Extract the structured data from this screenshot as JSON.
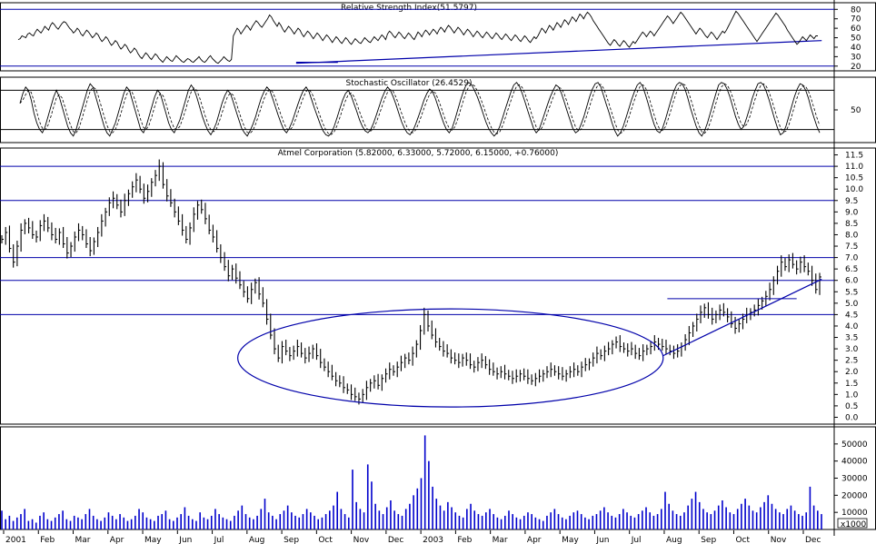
{
  "chart_data": [
    {
      "type": "line",
      "title": "Relative Strength Index(51.5797)",
      "y_ticks": [
        20,
        30,
        40,
        50,
        60,
        70,
        80
      ],
      "ylim": [
        15,
        87
      ],
      "horizontal_lines": [
        80,
        20
      ],
      "trendline_label": "",
      "trendlines": [
        {
          "x1": 0.355,
          "y1": 23,
          "x2": 0.985,
          "y2": 47
        },
        {
          "x1": 0.355,
          "y1": 24,
          "x2": 0.405,
          "y2": 24
        }
      ],
      "series": [
        {
          "values": [
            48,
            49,
            52,
            51,
            50,
            54,
            55,
            53,
            52,
            56,
            59,
            57,
            55,
            58,
            62,
            60,
            58,
            63,
            66,
            64,
            61,
            59,
            62,
            65,
            67,
            66,
            63,
            60,
            58,
            55,
            57,
            60,
            58,
            54,
            52,
            55,
            58,
            56,
            53,
            50,
            52,
            55,
            53,
            49,
            46,
            48,
            51,
            49,
            45,
            42,
            44,
            47,
            45,
            41,
            38,
            40,
            43,
            41,
            37,
            34,
            36,
            39,
            37,
            33,
            30,
            28,
            31,
            34,
            32,
            29,
            27,
            30,
            33,
            31,
            28,
            26,
            24,
            27,
            30,
            28,
            26,
            25,
            28,
            31,
            29,
            27,
            25,
            24,
            26,
            28,
            27,
            25,
            24,
            26,
            28,
            30,
            27,
            25,
            24,
            26,
            29,
            31,
            28,
            26,
            24,
            23,
            25,
            27,
            30,
            28,
            26,
            25,
            27,
            52,
            56,
            60,
            58,
            54,
            57,
            60,
            63,
            61,
            58,
            62,
            65,
            68,
            66,
            63,
            61,
            64,
            67,
            70,
            74,
            72,
            68,
            65,
            62,
            66,
            63,
            59,
            56,
            59,
            62,
            60,
            57,
            54,
            57,
            60,
            58,
            54,
            51,
            54,
            57,
            55,
            52,
            49,
            52,
            55,
            53,
            50,
            47,
            50,
            53,
            51,
            48,
            45,
            48,
            51,
            49,
            46,
            44,
            47,
            50,
            48,
            45,
            43,
            46,
            49,
            47,
            45,
            44,
            47,
            50,
            48,
            46,
            45,
            48,
            51,
            49,
            47,
            50,
            53,
            51,
            48,
            54,
            57,
            55,
            52,
            50,
            53,
            56,
            54,
            51,
            49,
            52,
            55,
            53,
            50,
            48,
            52,
            56,
            54,
            51,
            55,
            58,
            56,
            53,
            56,
            59,
            57,
            54,
            58,
            61,
            59,
            56,
            60,
            63,
            61,
            58,
            55,
            58,
            61,
            59,
            56,
            53,
            56,
            59,
            57,
            54,
            51,
            54,
            57,
            55,
            52,
            50,
            53,
            56,
            54,
            51,
            49,
            52,
            55,
            53,
            50,
            48,
            51,
            54,
            52,
            49,
            47,
            50,
            53,
            51,
            48,
            46,
            49,
            52,
            50,
            47,
            45,
            48,
            51,
            49,
            52,
            56,
            60,
            58,
            55,
            59,
            63,
            61,
            58,
            62,
            66,
            64,
            61,
            65,
            69,
            67,
            64,
            68,
            72,
            70,
            67,
            71,
            75,
            73,
            70,
            74,
            77,
            75,
            72,
            68,
            65,
            62,
            59,
            56,
            53,
            50,
            47,
            44,
            42,
            45,
            48,
            46,
            43,
            41,
            44,
            47,
            45,
            42,
            40,
            43,
            46,
            44,
            47,
            50,
            53,
            56,
            54,
            51,
            54,
            57,
            55,
            52,
            55,
            58,
            61,
            64,
            67,
            70,
            73,
            71,
            68,
            65,
            68,
            71,
            74,
            77,
            75,
            72,
            69,
            66,
            63,
            60,
            57,
            54,
            57,
            60,
            58,
            55,
            52,
            50,
            53,
            56,
            54,
            51,
            48,
            51,
            54,
            57,
            55,
            58,
            62,
            66,
            70,
            74,
            78,
            76,
            73,
            70,
            67,
            64,
            61,
            58,
            55,
            52,
            49,
            46,
            49,
            52,
            55,
            58,
            61,
            64,
            67,
            70,
            73,
            76,
            74,
            71,
            68,
            65,
            62,
            58,
            55,
            52,
            49,
            46,
            43,
            45,
            48,
            51,
            49,
            47,
            50,
            53,
            51,
            49,
            52,
            52
          ]
        }
      ]
    },
    {
      "type": "line",
      "title": "Stochastic Oscillator (26.4529)",
      "y_ticks": [
        50
      ],
      "ylim": [
        0,
        100
      ],
      "horizontal_lines": [
        80,
        20
      ],
      "series": [
        {
          "style": "solid"
        },
        {
          "style": "dashed"
        }
      ],
      "values": [
        60,
        75,
        85,
        80,
        65,
        45,
        30,
        20,
        15,
        25,
        40,
        55,
        70,
        80,
        70,
        55,
        40,
        25,
        15,
        10,
        20,
        35,
        50,
        65,
        80,
        90,
        85,
        70,
        55,
        40,
        25,
        15,
        10,
        20,
        30,
        45,
        60,
        75,
        85,
        80,
        65,
        50,
        35,
        20,
        15,
        25,
        40,
        55,
        70,
        80,
        75,
        60,
        45,
        30,
        20,
        15,
        25,
        35,
        50,
        65,
        80,
        88,
        82,
        70,
        55,
        40,
        28,
        18,
        12,
        20,
        30,
        45,
        60,
        72,
        80,
        75,
        62,
        48,
        35,
        22,
        15,
        10,
        18,
        28,
        40,
        55,
        68,
        78,
        85,
        80,
        68,
        55,
        42,
        30,
        20,
        15,
        22,
        32,
        45,
        58,
        70,
        80,
        85,
        78,
        65,
        52,
        40,
        28,
        18,
        12,
        10,
        15,
        25,
        38,
        52,
        65,
        75,
        80,
        72,
        60,
        48,
        35,
        25,
        18,
        15,
        20,
        30,
        42,
        55,
        68,
        78,
        85,
        80,
        70,
        58,
        45,
        32,
        22,
        15,
        12,
        18,
        28,
        40,
        52,
        65,
        75,
        82,
        78,
        68,
        55,
        42,
        30,
        20,
        15,
        22,
        35,
        50,
        65,
        78,
        88,
        92,
        88,
        80,
        70,
        58,
        45,
        32,
        22,
        15,
        10,
        15,
        25,
        38,
        52,
        65,
        78,
        88,
        92,
        86,
        75,
        62,
        48,
        35,
        22,
        15,
        20,
        32,
        45,
        58,
        70,
        80,
        88,
        85,
        75,
        62,
        48,
        35,
        22,
        15,
        18,
        28,
        40,
        55,
        70,
        82,
        90,
        92,
        85,
        72,
        58,
        45,
        30,
        18,
        10,
        15,
        25,
        38,
        52,
        66,
        78,
        88,
        92,
        85,
        72,
        58,
        42,
        28,
        18,
        15,
        22,
        35,
        50,
        65,
        78,
        88,
        92,
        90,
        82,
        68,
        52,
        38,
        25,
        15,
        10,
        18,
        30,
        45,
        60,
        75,
        88,
        92,
        90,
        82,
        70,
        55,
        40,
        28,
        20,
        25,
        38,
        52,
        68,
        80,
        90,
        92,
        88,
        78,
        65,
        50,
        35,
        22,
        12,
        15,
        25,
        40,
        55,
        70,
        82,
        90,
        88,
        80,
        68,
        52,
        38,
        25,
        15
      ]
    },
    {
      "type": "bar",
      "title": "Atmel Corporation (5.82000, 6.33000, 5.72000, 6.15000, +0.76000)",
      "y_ticks": [
        0.0,
        0.5,
        1.0,
        1.5,
        2.0,
        2.5,
        3.0,
        3.5,
        4.0,
        4.5,
        5.0,
        5.5,
        6.0,
        6.5,
        7.0,
        7.5,
        8.0,
        8.5,
        9.0,
        9.5,
        10.0,
        10.5,
        11.0,
        11.5
      ],
      "ylim": [
        -0.3,
        11.8
      ],
      "horizontal_lines": [
        11.0,
        9.5,
        7.0,
        6.0,
        4.5
      ],
      "support_lines": [
        {
          "x1": 0.8,
          "y1": 5.2,
          "x2": 0.955,
          "y2": 5.2
        }
      ],
      "trendlines": [
        {
          "x1": 0.795,
          "y1": 2.7,
          "x2": 0.985,
          "y2": 6.05
        }
      ],
      "ellipse": {
        "cx": 0.54,
        "cy": 2.6,
        "rx": 0.255,
        "ry": 2.15
      },
      "close": [
        7.8,
        8.1,
        7.4,
        6.8,
        7.5,
        8.2,
        8.5,
        8.3,
        8.0,
        7.9,
        8.4,
        8.6,
        8.3,
        8.0,
        7.8,
        8.1,
        7.6,
        7.2,
        7.5,
        7.9,
        8.2,
        8.0,
        7.6,
        7.3,
        7.7,
        8.1,
        8.6,
        9.0,
        9.4,
        9.6,
        9.3,
        9.0,
        9.5,
        9.8,
        10.1,
        10.4,
        10.0,
        9.6,
        9.9,
        10.3,
        10.6,
        11.0,
        10.2,
        9.7,
        9.4,
        9.0,
        8.6,
        8.2,
        7.8,
        8.3,
        8.9,
        9.3,
        9.1,
        8.7,
        8.2,
        7.9,
        7.4,
        7.0,
        6.6,
        6.2,
        6.5,
        6.1,
        5.8,
        5.5,
        5.2,
        5.6,
        5.9,
        5.4,
        5.0,
        4.3,
        3.6,
        3.0,
        2.6,
        3.1,
        2.9,
        2.7,
        2.9,
        3.1,
        2.8,
        2.6,
        2.8,
        3.0,
        2.7,
        2.4,
        2.2,
        2.0,
        1.8,
        1.6,
        1.5,
        1.3,
        1.2,
        1.0,
        0.9,
        0.8,
        1.0,
        1.3,
        1.5,
        1.6,
        1.4,
        1.7,
        1.9,
        2.1,
        2.0,
        2.2,
        2.4,
        2.6,
        2.5,
        2.8,
        3.2,
        3.8,
        4.5,
        4.0,
        3.6,
        3.3,
        3.1,
        2.9,
        2.8,
        2.6,
        2.5,
        2.4,
        2.6,
        2.5,
        2.3,
        2.2,
        2.4,
        2.5,
        2.3,
        2.1,
        2.0,
        1.9,
        2.0,
        1.9,
        1.8,
        1.7,
        1.8,
        1.9,
        1.8,
        1.7,
        1.6,
        1.7,
        1.8,
        1.9,
        2.0,
        2.1,
        2.0,
        1.9,
        1.8,
        1.9,
        2.0,
        2.1,
        2.0,
        2.2,
        2.3,
        2.4,
        2.6,
        2.8,
        2.7,
        2.9,
        3.0,
        3.2,
        3.3,
        3.1,
        3.0,
        2.9,
        3.0,
        2.8,
        2.7,
        2.9,
        3.0,
        3.1,
        3.3,
        3.2,
        3.1,
        3.0,
        2.9,
        2.8,
        2.9,
        3.1,
        3.4,
        3.7,
        4.0,
        4.3,
        4.6,
        4.8,
        4.5,
        4.3,
        4.5,
        4.7,
        4.6,
        4.4,
        4.1,
        3.9,
        4.1,
        4.3,
        4.5,
        4.6,
        4.7,
        4.9,
        5.1,
        5.3,
        5.6,
        6.0,
        6.4,
        6.8,
        6.6,
        6.9,
        6.7,
        6.5,
        6.8,
        6.6,
        6.4,
        6.0,
        5.6,
        6.15
      ]
    },
    {
      "type": "bar",
      "title": "",
      "y_ticks": [
        "10000",
        "20000",
        "30000",
        "40000",
        "50000"
      ],
      "ylim": [
        0,
        60
      ],
      "unit_label": "x1000",
      "values": [
        11,
        6,
        8,
        5,
        7,
        9,
        12,
        5,
        6,
        4,
        8,
        10,
        6,
        5,
        7,
        9,
        11,
        6,
        5,
        8,
        7,
        6,
        9,
        12,
        8,
        6,
        5,
        7,
        10,
        8,
        6,
        9,
        7,
        5,
        6,
        8,
        12,
        10,
        7,
        6,
        5,
        8,
        9,
        11,
        6,
        5,
        7,
        9,
        13,
        8,
        6,
        5,
        10,
        7,
        6,
        8,
        12,
        9,
        7,
        6,
        5,
        8,
        11,
        14,
        9,
        7,
        6,
        8,
        12,
        18,
        10,
        8,
        6,
        9,
        11,
        14,
        10,
        8,
        7,
        9,
        12,
        10,
        8,
        6,
        7,
        9,
        11,
        14,
        22,
        12,
        9,
        7,
        35,
        16,
        12,
        10,
        38,
        28,
        15,
        11,
        9,
        13,
        17,
        11,
        9,
        8,
        12,
        15,
        20,
        24,
        30,
        55,
        40,
        25,
        18,
        14,
        11,
        16,
        13,
        10,
        8,
        7,
        12,
        15,
        11,
        9,
        8,
        10,
        12,
        9,
        7,
        6,
        8,
        11,
        9,
        7,
        6,
        8,
        10,
        9,
        7,
        6,
        5,
        8,
        10,
        12,
        9,
        7,
        6,
        8,
        10,
        11,
        9,
        7,
        6,
        8,
        9,
        11,
        13,
        10,
        8,
        7,
        9,
        12,
        10,
        8,
        7,
        9,
        11,
        13,
        10,
        8,
        9,
        12,
        22,
        15,
        11,
        9,
        8,
        10,
        14,
        18,
        22,
        16,
        12,
        10,
        9,
        11,
        14,
        17,
        13,
        10,
        9,
        12,
        15,
        18,
        14,
        11,
        10,
        13,
        16,
        20,
        15,
        12,
        10,
        9,
        12,
        14,
        11,
        9,
        8,
        10,
        25,
        14,
        11,
        9
      ]
    }
  ],
  "x_axis": {
    "labels": [
      "2001",
      "Feb",
      "Mar",
      "Apr",
      "May",
      "Jun",
      "Jul",
      "Aug",
      "Sep",
      "Oct",
      "Nov",
      "Dec",
      "2003",
      "Feb",
      "Mar",
      "Apr",
      "May",
      "Jun",
      "Jul",
      "Aug",
      "Sep",
      "Oct",
      "Nov",
      "Dec"
    ]
  },
  "colors": {
    "price": "#000000",
    "volume": "#0000cc",
    "reference_lines": "#0000aa",
    "panel_border": "#000000"
  }
}
